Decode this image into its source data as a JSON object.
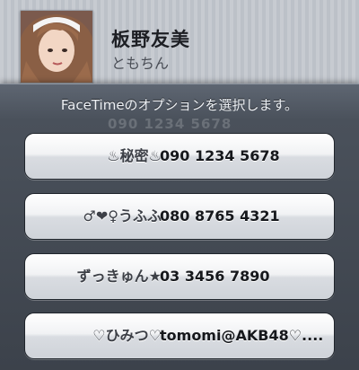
{
  "contact": {
    "name": "板野友美",
    "nickname": "ともちん"
  },
  "sheet": {
    "title": "FaceTimeのオプションを選択します。",
    "ghost_text": "090 1234 5678"
  },
  "options": [
    {
      "label": "♨秘密♨",
      "value": "090 1234 5678"
    },
    {
      "label": "♂❤♀うふふ",
      "value": "080 8765 4321"
    },
    {
      "label": "ずっきゅん★",
      "value": "03 3456 7890"
    },
    {
      "label": "♡ひみつ♡",
      "value": "tomomi@AKB48♡...."
    }
  ],
  "colors": {
    "sheet_bg": "#4a515b",
    "button_face": "#f1f2f4"
  }
}
